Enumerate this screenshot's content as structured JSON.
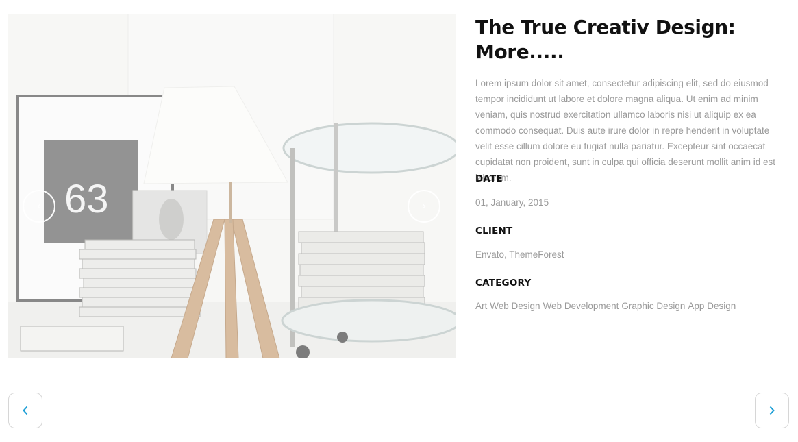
{
  "project": {
    "title": "The True Creativ Design: More.....",
    "description": "Lorem ipsum dolor sit amet, consectetur adipiscing elit, sed do eiusmod tempor incididunt ut labore et dolore magna aliqua. Ut enim ad minim veniam, quis nostrud exercitation ullamco laboris nisi ut aliquip ex ea commodo consequat. Duis aute irure dolor in repre henderit in voluptate velit esse cillum dolore eu fugiat nulla pariatur. Excepteur sint occaecat cupidatat non proident, sunt in culpa qui officia deserunt mollit anim id est laborum."
  },
  "meta": {
    "date_label": "DATE",
    "date_value": "01, January, 2015",
    "client_label": "CLIENT",
    "client_value": "Envato, ThemeForest",
    "category_label": "CATEGORY",
    "categories": [
      "Art",
      "Web Design",
      "Web Development",
      "Graphic Design",
      "App Design"
    ]
  },
  "slider": {
    "frame_number": "63",
    "prev_icon": "chevron-left-icon",
    "next_icon": "chevron-right-icon"
  },
  "nav": {
    "prev_icon": "chevron-left-icon",
    "next_icon": "chevron-right-icon",
    "accent_color": "#1e9fd6"
  }
}
